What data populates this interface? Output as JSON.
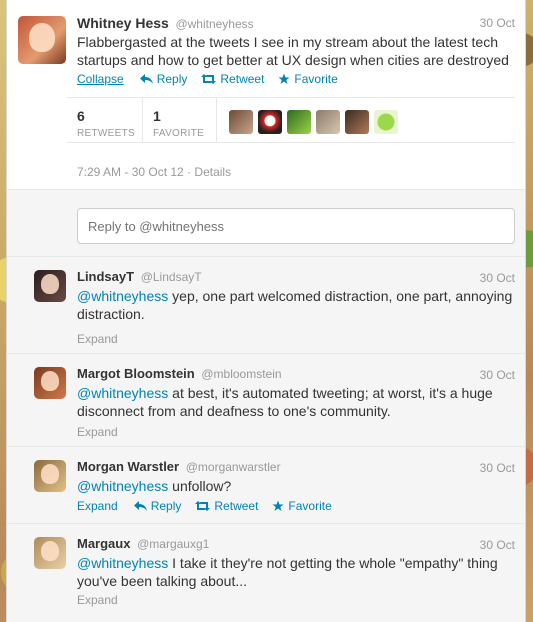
{
  "main_tweet": {
    "name": "Whitney Hess",
    "handle": "@whitneyhess",
    "date": "30 Oct",
    "text": "Flabbergasted at the tweets I see in my stream about the latest tech startups and how to get better at UX design when cities are destroyed",
    "actions": {
      "collapse": "Collapse",
      "reply": "Reply",
      "retweet": "Retweet",
      "favorite": "Favorite"
    },
    "stats": {
      "retweets_count": "6",
      "retweets_label": "RETWEETS",
      "favorites_count": "1",
      "favorites_label": "FAVORITE"
    },
    "timestamp": "7:29 AM - 30 Oct 12",
    "details": "Details"
  },
  "reply_box": {
    "placeholder": "Reply to @whitneyhess"
  },
  "replies": [
    {
      "name": "LindsayT",
      "handle": "@LindsayT",
      "date": "30 Oct",
      "mention": "@whitneyhess",
      "text": " yep, one part welcomed distraction, one part, annoying distraction.",
      "expand": "Expand"
    },
    {
      "name": "Margot Bloomstein",
      "handle": "@mbloomstein",
      "date": "30 Oct",
      "mention": "@whitneyhess",
      "text": " at best, it's automated tweeting; at worst, it's a huge disconnect from and deafness to one's community.",
      "expand": "Expand"
    },
    {
      "name": "Morgan Warstler",
      "handle": "@morganwarstler",
      "date": "30 Oct",
      "mention": "@whitneyhess",
      "text": " unfollow?",
      "expand": "Expand",
      "reply": "Reply",
      "retweet": "Retweet",
      "favorite": "Favorite"
    },
    {
      "name": "Margaux",
      "handle": "@margauxg1",
      "date": "30 Oct",
      "mention": "@whitneyhess",
      "text": " I take it they're not getting the whole \"empathy\" thing you've been talking about...",
      "expand": "Expand"
    }
  ],
  "colors": {
    "link": "#0084b4",
    "muted": "#999999",
    "text": "#333333"
  },
  "icons": [
    "reply-icon",
    "retweet-icon",
    "favorite-star-icon"
  ]
}
